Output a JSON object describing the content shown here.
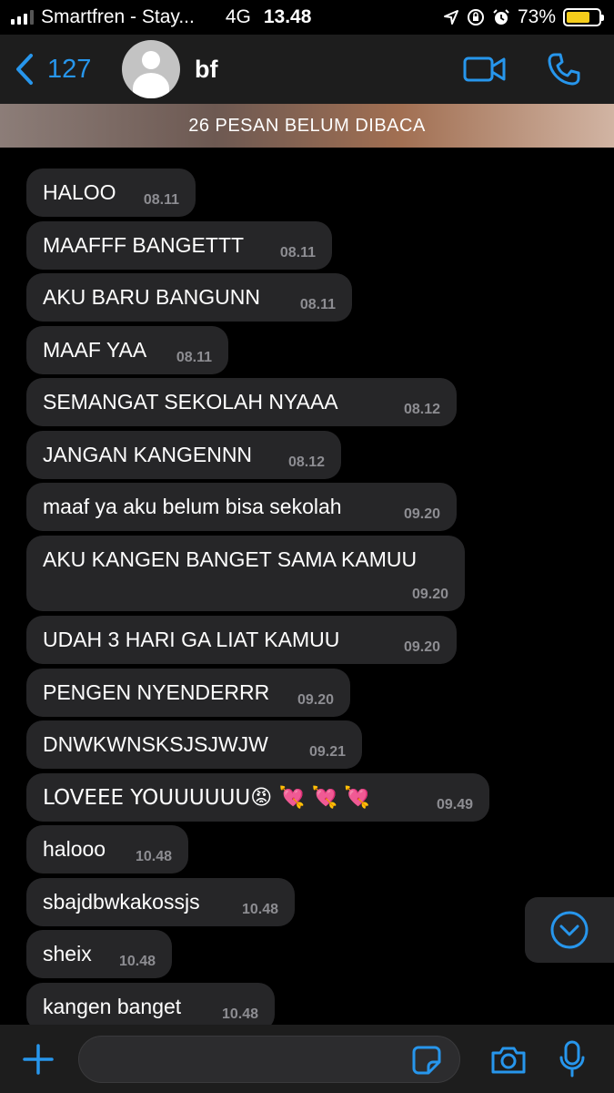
{
  "status_bar": {
    "carrier": "Smartfren - Stay...",
    "network": "4G",
    "time": "13.48",
    "battery_percent": "73%",
    "battery_level": 0.73,
    "battery_color": "#f5cd1b"
  },
  "header": {
    "back_count": "127",
    "contact_name": "bf",
    "accent_color": "#2796ec"
  },
  "unread_banner": "26 PESAN BELUM DIBACA",
  "messages": [
    {
      "text": "HALOO",
      "time": "08.11"
    },
    {
      "text": "MAAFFF BANGETTT",
      "time": "08.11"
    },
    {
      "text": "AKU BARU BANGUNN",
      "time": "08.11"
    },
    {
      "text": "MAAF YAA",
      "time": "08.11"
    },
    {
      "text": "SEMANGAT SEKOLAH NYAAA",
      "time": "08.12"
    },
    {
      "text": "JANGAN KANGENNN",
      "time": "08.12"
    },
    {
      "text": "maaf ya aku belum bisa sekolah",
      "time": "09.20"
    },
    {
      "text": "AKU KANGEN BANGET SAMA KAMUU",
      "time": "09.20"
    },
    {
      "text": "UDAH 3 HARI GA LIAT KAMUU",
      "time": "09.20"
    },
    {
      "text": "PENGEN NYENDERRR",
      "time": "09.20"
    },
    {
      "text": "DNWKWNSKSJSJWJW",
      "time": "09.21"
    },
    {
      "text": "LOVEEE YOUUUUUU😡 💘 💘 💘",
      "time": "09.49"
    },
    {
      "text": "halooo",
      "time": "10.48"
    },
    {
      "text": "sbajdbwkakossjs",
      "time": "10.48"
    },
    {
      "text": "sheix",
      "time": "10.48"
    },
    {
      "text": "kangen banget",
      "time": "10.48"
    }
  ],
  "input": {
    "placeholder": ""
  },
  "icons": {
    "back": "chevron-left-icon",
    "video": "video-camera-icon",
    "call": "phone-icon",
    "scroll": "chevron-down-circle-icon",
    "add": "plus-icon",
    "sticker": "sticker-icon",
    "camera": "camera-icon",
    "mic": "microphone-icon"
  }
}
